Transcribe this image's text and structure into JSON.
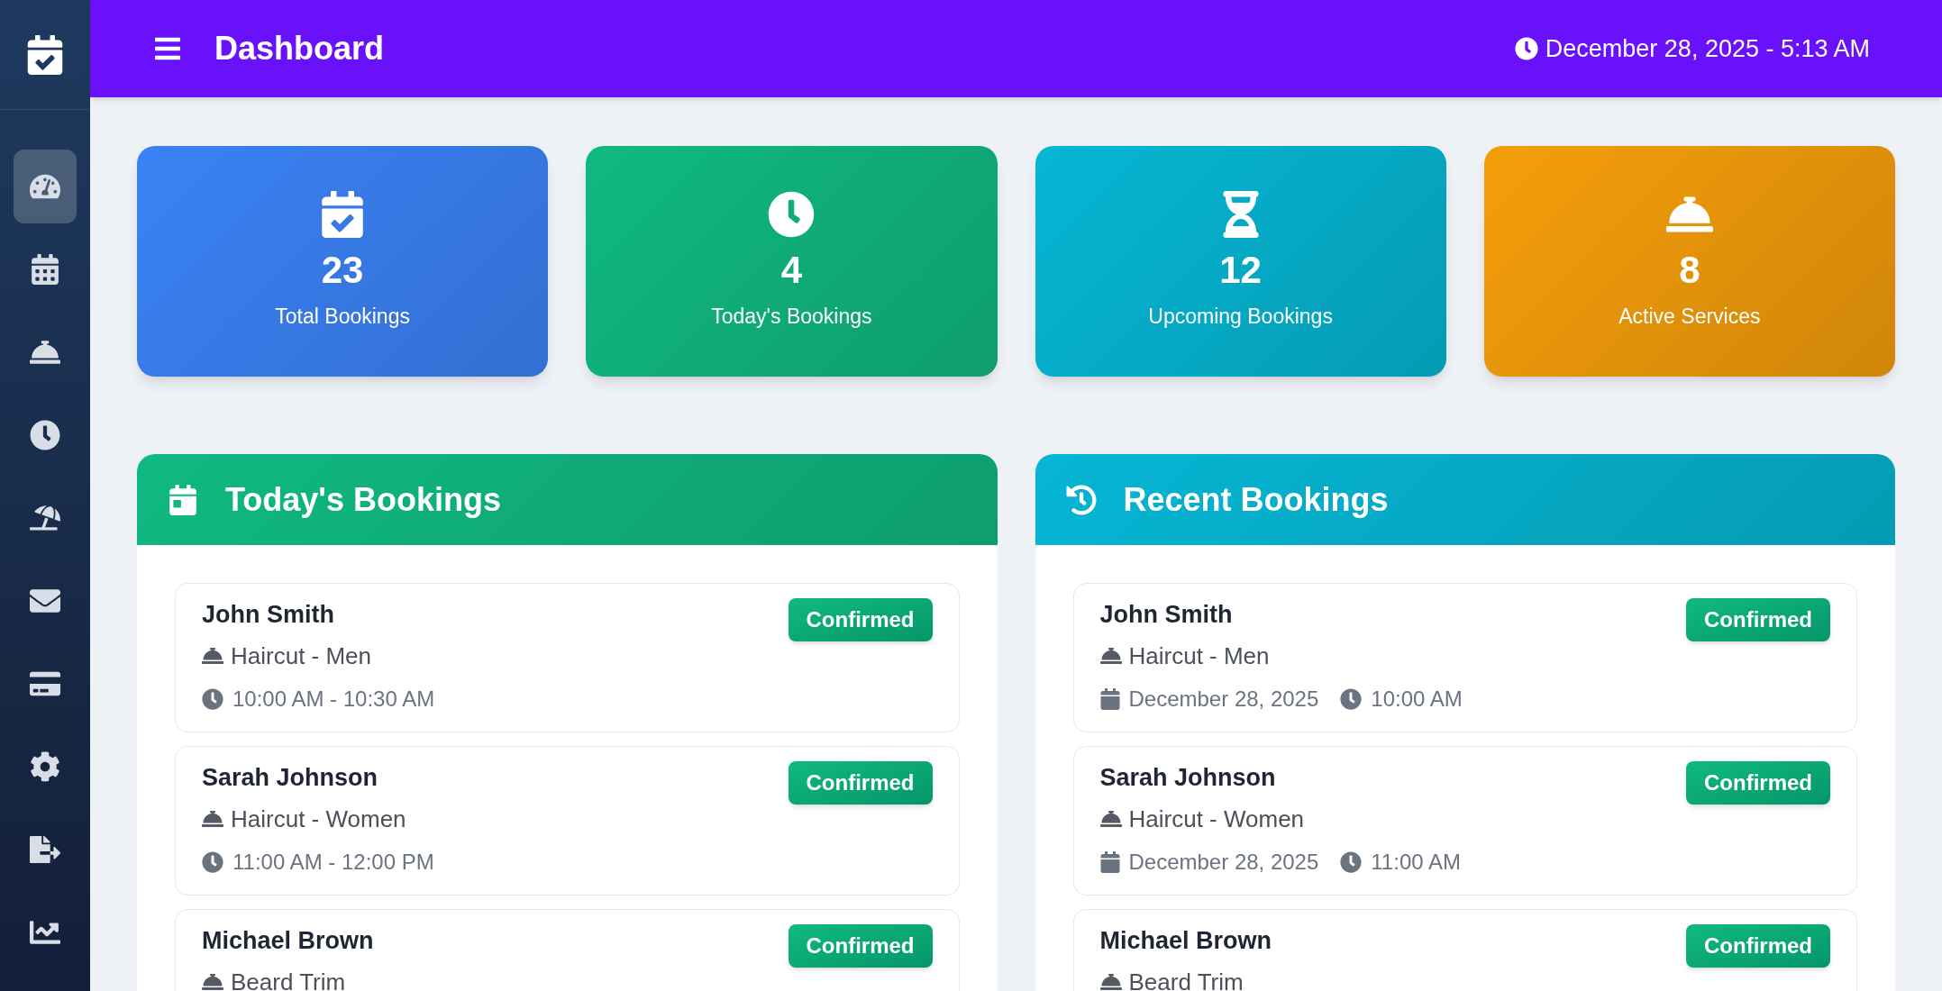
{
  "sidebar": {
    "items": [
      {
        "selected": true
      },
      {
        "selected": false
      },
      {
        "selected": false
      },
      {
        "selected": false
      },
      {
        "selected": false
      },
      {
        "selected": false
      },
      {
        "selected": false
      },
      {
        "selected": false
      },
      {
        "selected": false
      },
      {
        "selected": false
      }
    ]
  },
  "header": {
    "title": "Dashboard",
    "datetime": "December 28, 2025 - 5:13 AM"
  },
  "stats": [
    {
      "value": "23",
      "label": "Total Bookings",
      "color": "#3b82f6"
    },
    {
      "value": "4",
      "label": "Today's Bookings",
      "color": "#10b981"
    },
    {
      "value": "12",
      "label": "Upcoming Bookings",
      "color": "#06b6d4"
    },
    {
      "value": "8",
      "label": "Active Services",
      "color": "#f59e0b"
    }
  ],
  "panels": [
    {
      "title": "Today's Bookings",
      "color": "#10b981",
      "bookings": [
        {
          "name": "John Smith",
          "service": "Haircut - Men",
          "time": "10:00 AM - 10:30 AM",
          "status": "Confirmed"
        },
        {
          "name": "Sarah Johnson",
          "service": "Haircut - Women",
          "time": "11:00 AM - 12:00 PM",
          "status": "Confirmed"
        },
        {
          "name": "Michael Brown",
          "service": "Beard Trim",
          "status": "Confirmed"
        }
      ]
    },
    {
      "title": "Recent Bookings",
      "color": "#06b6d4",
      "bookings": [
        {
          "name": "John Smith",
          "service": "Haircut - Men",
          "date": "December 28, 2025",
          "time": "10:00 AM",
          "status": "Confirmed"
        },
        {
          "name": "Sarah Johnson",
          "service": "Haircut - Women",
          "date": "December 28, 2025",
          "time": "11:00 AM",
          "status": "Confirmed"
        },
        {
          "name": "Michael Brown",
          "service": "Beard Trim",
          "status": "Confirmed"
        }
      ]
    }
  ]
}
